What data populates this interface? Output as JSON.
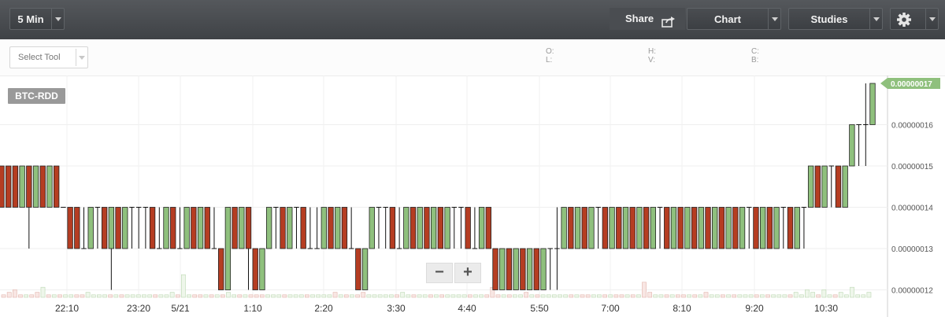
{
  "header": {
    "interval_label": "5 Min",
    "share_label": "Share",
    "chart_label": "Chart",
    "studies_label": "Studies",
    "icons": [
      "share-icon",
      "gear-icon"
    ]
  },
  "toolbar": {
    "select_tool_label": "Select Tool",
    "ohlc": {
      "o": "O:",
      "h": "H:",
      "c": "C:",
      "l": "L:",
      "v": "V:",
      "b": "B:"
    }
  },
  "zoom": {
    "minus": "−",
    "plus": "+"
  },
  "chart_data": {
    "type": "candlestick",
    "symbol": "BTC-RDD",
    "interval": "5 Min",
    "last_price": "0.00000017",
    "ylim": [
      1.2e-07,
      1.7e-07
    ],
    "y_ticks": [
      "0.00000016",
      "0.00000015",
      "0.00000014",
      "0.00000013",
      "0.00000012"
    ],
    "x_ticks": [
      "22:10",
      "23:20",
      "5/21",
      "1:10",
      "2:20",
      "3:30",
      "4:40",
      "5:50",
      "7:00",
      "8:10",
      "9:20",
      "10:30"
    ],
    "up_color": "#8fc07d",
    "down_color": "#b53d22",
    "grid": true,
    "candles": [
      {
        "o": 15,
        "c": 14,
        "h": 15,
        "l": 14
      },
      {
        "o": 15,
        "c": 14,
        "h": 15,
        "l": 14
      },
      {
        "o": 15,
        "c": 14,
        "h": 15,
        "l": 14
      },
      {
        "o": 14,
        "c": 15,
        "h": 15,
        "l": 14
      },
      {
        "o": 15,
        "c": 14,
        "h": 15,
        "l": 13
      },
      {
        "o": 14,
        "c": 15,
        "h": 15,
        "l": 14
      },
      {
        "o": 15,
        "c": 14,
        "h": 15,
        "l": 14
      },
      {
        "o": 14,
        "c": 15,
        "h": 15,
        "l": 14
      },
      {
        "o": 15,
        "c": 14,
        "h": 15,
        "l": 14
      },
      {
        "o": 14,
        "c": 14,
        "h": 14,
        "l": 14
      },
      {
        "o": 14,
        "c": 13,
        "h": 14,
        "l": 13
      },
      {
        "o": 14,
        "c": 13,
        "h": 14,
        "l": 13
      },
      {
        "o": 13,
        "c": 13,
        "h": 14,
        "l": 13
      },
      {
        "o": 13,
        "c": 14,
        "h": 14,
        "l": 13
      },
      {
        "o": 14,
        "c": 14,
        "h": 14,
        "l": 13
      },
      {
        "o": 14,
        "c": 13,
        "h": 14,
        "l": 13
      },
      {
        "o": 13,
        "c": 14,
        "h": 14,
        "l": 12
      },
      {
        "o": 14,
        "c": 13,
        "h": 14,
        "l": 13
      },
      {
        "o": 13,
        "c": 14,
        "h": 14,
        "l": 13
      },
      {
        "o": 14,
        "c": 14,
        "h": 14,
        "l": 13
      },
      {
        "o": 14,
        "c": 14,
        "h": 14,
        "l": 13
      },
      {
        "o": 14,
        "c": 14,
        "h": 14,
        "l": 13
      },
      {
        "o": 14,
        "c": 13,
        "h": 14,
        "l": 13
      },
      {
        "o": 13,
        "c": 13,
        "h": 14,
        "l": 13
      },
      {
        "o": 13,
        "c": 14,
        "h": 14,
        "l": 13
      },
      {
        "o": 14,
        "c": 13,
        "h": 14,
        "l": 13
      },
      {
        "o": 13,
        "c": 13,
        "h": 14,
        "l": 13
      },
      {
        "o": 13,
        "c": 14,
        "h": 14,
        "l": 13
      },
      {
        "o": 14,
        "c": 13,
        "h": 14,
        "l": 13
      },
      {
        "o": 13,
        "c": 14,
        "h": 14,
        "l": 13
      },
      {
        "o": 14,
        "c": 13,
        "h": 14,
        "l": 13
      },
      {
        "o": 13,
        "c": 13,
        "h": 14,
        "l": 13
      },
      {
        "o": 13,
        "c": 12,
        "h": 13,
        "l": 12
      },
      {
        "o": 12,
        "c": 14,
        "h": 14,
        "l": 12
      },
      {
        "o": 14,
        "c": 13,
        "h": 14,
        "l": 13
      },
      {
        "o": 13,
        "c": 14,
        "h": 14,
        "l": 13
      },
      {
        "o": 14,
        "c": 13,
        "h": 14,
        "l": 12
      },
      {
        "o": 13,
        "c": 12,
        "h": 13,
        "l": 12
      },
      {
        "o": 12,
        "c": 13,
        "h": 13,
        "l": 12
      },
      {
        "o": 13,
        "c": 14,
        "h": 14,
        "l": 13
      },
      {
        "o": 14,
        "c": 14,
        "h": 14,
        "l": 13
      },
      {
        "o": 14,
        "c": 13,
        "h": 14,
        "l": 13
      },
      {
        "o": 13,
        "c": 14,
        "h": 14,
        "l": 13
      },
      {
        "o": 14,
        "c": 14,
        "h": 14,
        "l": 13
      },
      {
        "o": 14,
        "c": 13,
        "h": 14,
        "l": 13
      },
      {
        "o": 13,
        "c": 13,
        "h": 14,
        "l": 13
      },
      {
        "o": 13,
        "c": 13,
        "h": 14,
        "l": 13
      },
      {
        "o": 13,
        "c": 14,
        "h": 14,
        "l": 13
      },
      {
        "o": 14,
        "c": 13,
        "h": 14,
        "l": 13
      },
      {
        "o": 13,
        "c": 14,
        "h": 14,
        "l": 13
      },
      {
        "o": 14,
        "c": 13,
        "h": 14,
        "l": 13
      },
      {
        "o": 13,
        "c": 13,
        "h": 14,
        "l": 13
      },
      {
        "o": 13,
        "c": 12,
        "h": 13,
        "l": 12
      },
      {
        "o": 12,
        "c": 13,
        "h": 13,
        "l": 12
      },
      {
        "o": 13,
        "c": 14,
        "h": 14,
        "l": 13
      },
      {
        "o": 14,
        "c": 14,
        "h": 14,
        "l": 13
      },
      {
        "o": 14,
        "c": 14,
        "h": 14,
        "l": 13
      },
      {
        "o": 14,
        "c": 13,
        "h": 14,
        "l": 13
      },
      {
        "o": 13,
        "c": 13,
        "h": 14,
        "l": 13
      },
      {
        "o": 13,
        "c": 14,
        "h": 14,
        "l": 13
      },
      {
        "o": 14,
        "c": 13,
        "h": 14,
        "l": 13
      },
      {
        "o": 13,
        "c": 14,
        "h": 14,
        "l": 13
      },
      {
        "o": 14,
        "c": 13,
        "h": 14,
        "l": 13
      },
      {
        "o": 13,
        "c": 14,
        "h": 14,
        "l": 13
      },
      {
        "o": 14,
        "c": 13,
        "h": 14,
        "l": 13
      },
      {
        "o": 13,
        "c": 14,
        "h": 14,
        "l": 13
      },
      {
        "o": 14,
        "c": 14,
        "h": 14,
        "l": 13
      },
      {
        "o": 14,
        "c": 14,
        "h": 14,
        "l": 13
      },
      {
        "o": 14,
        "c": 13,
        "h": 14,
        "l": 13
      },
      {
        "o": 13,
        "c": 13,
        "h": 14,
        "l": 13
      },
      {
        "o": 13,
        "c": 14,
        "h": 14,
        "l": 13
      },
      {
        "o": 14,
        "c": 13,
        "h": 14,
        "l": 13
      },
      {
        "o": 13,
        "c": 12,
        "h": 13,
        "l": 12
      },
      {
        "o": 12,
        "c": 13,
        "h": 13,
        "l": 12
      },
      {
        "o": 13,
        "c": 12,
        "h": 13,
        "l": 12
      },
      {
        "o": 12,
        "c": 13,
        "h": 13,
        "l": 12
      },
      {
        "o": 13,
        "c": 12,
        "h": 13,
        "l": 12
      },
      {
        "o": 12,
        "c": 13,
        "h": 13,
        "l": 12
      },
      {
        "o": 13,
        "c": 12,
        "h": 13,
        "l": 12
      },
      {
        "o": 12,
        "c": 13,
        "h": 13,
        "l": 12
      },
      {
        "o": 13,
        "c": 13,
        "h": 13,
        "l": 12
      },
      {
        "o": 13,
        "c": 13,
        "h": 14,
        "l": 12
      },
      {
        "o": 13,
        "c": 14,
        "h": 14,
        "l": 13
      },
      {
        "o": 14,
        "c": 13,
        "h": 14,
        "l": 13
      },
      {
        "o": 13,
        "c": 14,
        "h": 14,
        "l": 13
      },
      {
        "o": 14,
        "c": 13,
        "h": 14,
        "l": 13
      },
      {
        "o": 13,
        "c": 14,
        "h": 14,
        "l": 13
      },
      {
        "o": 14,
        "c": 14,
        "h": 14,
        "l": 13
      },
      {
        "o": 14,
        "c": 13,
        "h": 14,
        "l": 13
      },
      {
        "o": 13,
        "c": 14,
        "h": 14,
        "l": 13
      },
      {
        "o": 14,
        "c": 13,
        "h": 14,
        "l": 13
      },
      {
        "o": 13,
        "c": 14,
        "h": 14,
        "l": 13
      },
      {
        "o": 14,
        "c": 13,
        "h": 14,
        "l": 13
      },
      {
        "o": 13,
        "c": 14,
        "h": 14,
        "l": 13
      },
      {
        "o": 14,
        "c": 13,
        "h": 14,
        "l": 13
      },
      {
        "o": 13,
        "c": 14,
        "h": 14,
        "l": 13
      },
      {
        "o": 14,
        "c": 14,
        "h": 14,
        "l": 13
      },
      {
        "o": 14,
        "c": 13,
        "h": 14,
        "l": 13
      },
      {
        "o": 13,
        "c": 14,
        "h": 14,
        "l": 13
      },
      {
        "o": 14,
        "c": 13,
        "h": 14,
        "l": 13
      },
      {
        "o": 13,
        "c": 14,
        "h": 14,
        "l": 13
      },
      {
        "o": 14,
        "c": 13,
        "h": 14,
        "l": 13
      },
      {
        "o": 13,
        "c": 14,
        "h": 14,
        "l": 13
      },
      {
        "o": 14,
        "c": 13,
        "h": 14,
        "l": 13
      },
      {
        "o": 13,
        "c": 14,
        "h": 14,
        "l": 13
      },
      {
        "o": 14,
        "c": 13,
        "h": 14,
        "l": 13
      },
      {
        "o": 13,
        "c": 14,
        "h": 14,
        "l": 13
      },
      {
        "o": 14,
        "c": 13,
        "h": 14,
        "l": 13
      },
      {
        "o": 13,
        "c": 14,
        "h": 14,
        "l": 13
      },
      {
        "o": 14,
        "c": 14,
        "h": 14,
        "l": 13
      },
      {
        "o": 14,
        "c": 13,
        "h": 14,
        "l": 13
      },
      {
        "o": 13,
        "c": 14,
        "h": 14,
        "l": 13
      },
      {
        "o": 14,
        "c": 13,
        "h": 14,
        "l": 13
      },
      {
        "o": 13,
        "c": 14,
        "h": 14,
        "l": 13
      },
      {
        "o": 14,
        "c": 14,
        "h": 14,
        "l": 13
      },
      {
        "o": 14,
        "c": 13,
        "h": 14,
        "l": 13
      },
      {
        "o": 13,
        "c": 14,
        "h": 14,
        "l": 13
      },
      {
        "o": 14,
        "c": 14,
        "h": 14,
        "l": 13
      },
      {
        "o": 14,
        "c": 15,
        "h": 15,
        "l": 14
      },
      {
        "o": 15,
        "c": 14,
        "h": 15,
        "l": 14
      },
      {
        "o": 14,
        "c": 15,
        "h": 15,
        "l": 14
      },
      {
        "o": 15,
        "c": 15,
        "h": 15,
        "l": 14
      },
      {
        "o": 15,
        "c": 14,
        "h": 15,
        "l": 14
      },
      {
        "o": 14,
        "c": 15,
        "h": 15,
        "l": 14
      },
      {
        "o": 15,
        "c": 16,
        "h": 16,
        "l": 15
      },
      {
        "o": 16,
        "c": 16,
        "h": 16,
        "l": 15
      },
      {
        "o": 16,
        "c": 16,
        "h": 17,
        "l": 15
      },
      {
        "o": 16,
        "c": 17,
        "h": 17,
        "l": 16
      }
    ],
    "volumes": [
      1,
      2,
      3,
      1,
      1,
      1,
      2,
      4,
      1,
      1,
      1,
      1,
      1,
      1,
      1,
      2,
      1,
      1,
      1,
      1,
      1,
      1,
      1,
      1,
      1,
      1,
      1,
      1,
      1,
      1,
      2,
      1,
      9,
      1,
      1,
      1,
      1,
      1,
      1,
      1,
      2,
      1,
      1,
      1,
      1,
      1,
      1,
      1,
      1,
      1,
      1,
      1,
      1,
      1,
      1,
      1,
      1,
      1,
      1,
      2,
      1,
      1,
      1,
      1,
      2,
      1,
      1,
      1,
      1,
      1,
      1,
      2,
      1,
      1,
      1,
      1,
      1,
      1,
      1,
      1,
      1,
      1,
      1,
      1,
      1,
      1,
      1,
      4,
      1,
      1,
      1,
      1,
      1,
      2,
      1,
      1,
      1,
      1,
      1,
      1,
      1,
      1,
      1,
      1,
      1,
      1,
      1,
      1,
      1,
      1,
      1,
      1,
      1,
      1,
      6,
      2,
      1,
      1,
      1,
      1,
      1,
      1,
      1,
      1,
      1,
      2,
      1,
      1,
      1,
      1,
      1,
      1,
      1,
      1,
      1,
      1,
      1,
      1,
      1,
      1,
      1,
      2,
      1,
      3,
      2,
      1,
      3,
      1,
      1,
      2,
      1,
      4,
      1,
      1,
      2
    ]
  }
}
